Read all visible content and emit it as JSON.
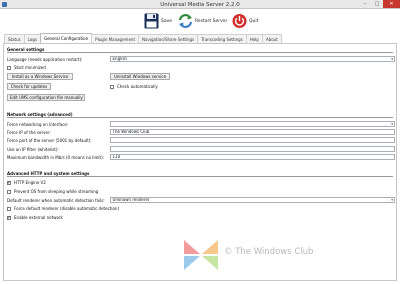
{
  "window": {
    "title": "Universal Media Server 2.2.0",
    "minimize_glyph": "–",
    "maximize_glyph": "□",
    "close_glyph": "✕"
  },
  "toolbar": {
    "save_label": "Save",
    "restart_label": "Restart Server",
    "quit_label": "Quit"
  },
  "tabs": [
    {
      "label": "Status"
    },
    {
      "label": "Logs"
    },
    {
      "label": "General Configuration",
      "active": true
    },
    {
      "label": "Plugin Management"
    },
    {
      "label": "Navigation/Share Settings"
    },
    {
      "label": "Transcoding Settings"
    },
    {
      "label": "Help"
    },
    {
      "label": "About"
    }
  ],
  "general": {
    "heading": "General settings",
    "language_label": "Language (needs application restart):",
    "language_value": "English",
    "start_minimized_label": "Start minimized",
    "start_minimized_checked": false,
    "install_service_label": "Install as a Windows Service",
    "uninstall_service_label": "Uninstall Windows service",
    "check_updates_label": "Check for updates",
    "check_auto_label": "Check automatically",
    "check_auto_checked": false,
    "edit_conf_label": "Edit UMS configuration file manually"
  },
  "network": {
    "heading": "Network settings (advanced)",
    "force_iface_label": "Force networking on interface:",
    "force_iface_value": "",
    "force_ip_label": "Force IP of the server:",
    "force_ip_value": "The Windows Club",
    "force_port_label": "Force port of the server (5001 by default):",
    "force_port_value": "",
    "ip_filter_label": "Use an IP filter (whitelist):",
    "ip_filter_value": "",
    "bandwidth_label": "Maximum bandwidth in Mb/s (0 means no limit):",
    "bandwidth_value": "110"
  },
  "advanced": {
    "heading": "Advanced HTTP and system settings",
    "http_engine_label": "HTTP Engine V2",
    "http_engine_checked": true,
    "prevent_sleep_label": "Prevent OS from sleeping while streaming",
    "prevent_sleep_checked": false,
    "default_renderer_label": "Default renderer when automatic detection fails:",
    "default_renderer_value": "Unknown renderer",
    "force_default_label": "Force default renderer (disable automatic detection)",
    "force_default_checked": false,
    "external_network_label": "Enable external network",
    "external_network_checked": true
  },
  "watermark": {
    "text": "The Windows Club",
    "colors": [
      "#e94c4c",
      "#f39a2c",
      "#9bd35a",
      "#4aa0e0"
    ]
  },
  "colors": {
    "close_button": "#c7372f",
    "save_icon": "#1a2f5a",
    "restart_icon_a": "#2f8a3a",
    "restart_icon_b": "#3a7dc4",
    "quit_icon": "#d0322e"
  }
}
